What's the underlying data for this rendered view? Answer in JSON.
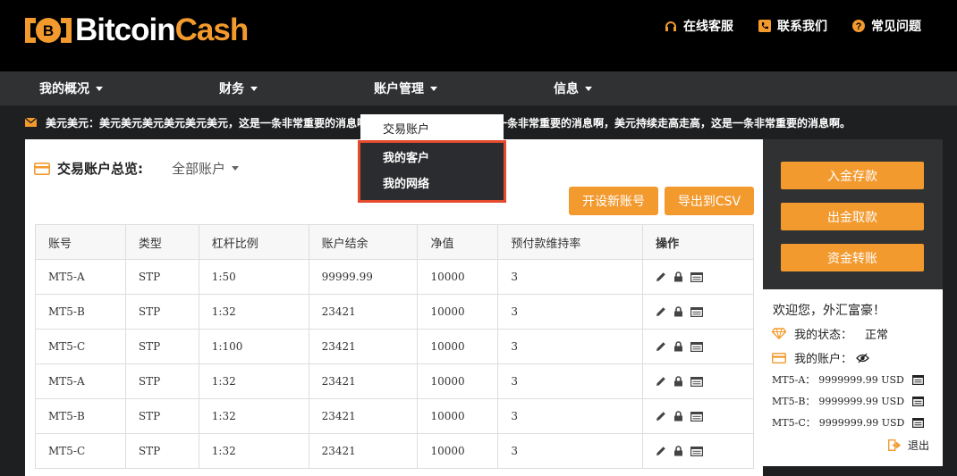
{
  "brand": {
    "name_white": "Bitcoin",
    "name_orange": "Cash",
    "icon": "bitcoin-icon",
    "accent": "#f39a2e"
  },
  "top_links": [
    {
      "label": "在线客服",
      "icon": "headset-icon"
    },
    {
      "label": "联系我们",
      "icon": "phone-icon"
    },
    {
      "label": "常见问题",
      "icon": "question-icon"
    }
  ],
  "nav": {
    "items": [
      {
        "label": "我的概况"
      },
      {
        "label": "财务"
      },
      {
        "label": "账户管理"
      },
      {
        "label": "信息"
      }
    ]
  },
  "notice": {
    "icon": "envelope-icon",
    "text": "美元美元：美元美元美元美元美元美元，这是一条非常重要的消息啊，美元持续走高走高，这是一条非常重要的消息啊，美元持续走高走高，这是一条非常重要的消息啊。"
  },
  "dropdown": {
    "items": [
      "交易账户",
      "我的客户",
      "我的网络"
    ]
  },
  "overview": {
    "title": "交易账户总览:",
    "icon": "credit-card-icon",
    "filter": "全部账户"
  },
  "actions": {
    "open_account": "开设新账号",
    "export_csv": "导出到CSV"
  },
  "table": {
    "headers": [
      "账号",
      "类型",
      "杠杆比例",
      "账户结余",
      "净值",
      "预付款维持率",
      "操作"
    ],
    "rows": [
      [
        "MT5-A",
        "STP",
        "1:50",
        "99999.99",
        "10000",
        "3"
      ],
      [
        "MT5-B",
        "STP",
        "1:32",
        "23421",
        "10000",
        "3"
      ],
      [
        "MT5-C",
        "STP",
        "1:100",
        "23421",
        "10000",
        "3"
      ],
      [
        "MT5-A",
        "STP",
        "1:32",
        "23421",
        "10000",
        "3"
      ],
      [
        "MT5-B",
        "STP",
        "1:32",
        "23421",
        "10000",
        "3"
      ],
      [
        "MT5-C",
        "STP",
        "1:32",
        "23421",
        "10000",
        "3"
      ]
    ],
    "row_icons": [
      "pencil-icon",
      "lock-icon",
      "list-icon"
    ]
  },
  "sidebar": {
    "buttons": [
      "入金存款",
      "出金取款",
      "资金转账"
    ],
    "welcome": "欢迎您，外汇富豪！",
    "status_label": "我的状态：",
    "status_value": "正常",
    "accounts_label": "我的账户：",
    "accounts": [
      {
        "name": "MT5-A：",
        "balance": "9999999.99 USD"
      },
      {
        "name": "MT5-B：",
        "balance": "9999999.99 USD"
      },
      {
        "name": "MT5-C：",
        "balance": "9999999.99 USD"
      }
    ],
    "logout": "退出"
  }
}
